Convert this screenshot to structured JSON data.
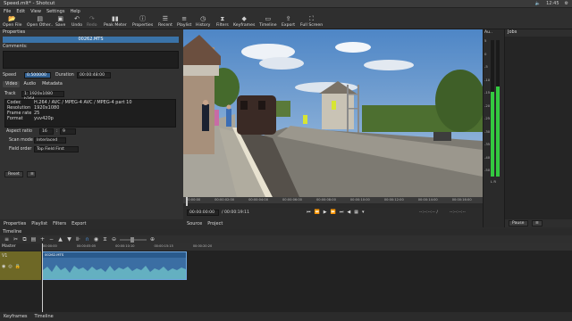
{
  "window": {
    "title": "Speed.mlt* - Shotcut",
    "clock": "12:45"
  },
  "menu": [
    "File",
    "Edit",
    "View",
    "Settings",
    "Help"
  ],
  "toolbar": [
    {
      "label": "Open File",
      "icon": "open-file-icon"
    },
    {
      "label": "Open Other..",
      "icon": "open-other-icon"
    },
    {
      "label": "Save",
      "icon": "save-icon"
    },
    {
      "label": "Undo",
      "icon": "undo-icon"
    },
    {
      "label": "Redo",
      "icon": "redo-icon"
    },
    {
      "label": "Peak Meter",
      "icon": "peak-meter-icon"
    },
    {
      "label": "Properties",
      "icon": "properties-icon"
    },
    {
      "label": "Recent",
      "icon": "recent-icon"
    },
    {
      "label": "Playlist",
      "icon": "playlist-icon"
    },
    {
      "label": "History",
      "icon": "history-icon"
    },
    {
      "label": "Filters",
      "icon": "filters-icon"
    },
    {
      "label": "Keyframes",
      "icon": "keyframes-icon"
    },
    {
      "label": "Timeline",
      "icon": "timeline-icon"
    },
    {
      "label": "Export",
      "icon": "export-icon"
    },
    {
      "label": "Full Screen",
      "icon": "fullscreen-icon"
    }
  ],
  "properties": {
    "header": "Properties",
    "clip_name": "00262.MTS",
    "comments_label": "Comments:",
    "speed_label": "Speed",
    "speed_value": "0.500000",
    "duration_label": "Duration",
    "duration_value": "00:00:48:00",
    "tabs": [
      "Video",
      "Audio",
      "Metadata"
    ],
    "track_label": "Track",
    "track_value": "1: 1920x1080 h264",
    "info": [
      {
        "k": "Codec",
        "v": "H.264 / AVC / MPEG-4 AVC / MPEG-4 part 10"
      },
      {
        "k": "Resolution",
        "v": "1920x1080"
      },
      {
        "k": "Frame rate",
        "v": "25"
      },
      {
        "k": "Format",
        "v": "yuv420p"
      }
    ],
    "aspect_label": "Aspect ratio",
    "aspect_w": "16",
    "aspect_h": "9",
    "scan_label": "Scan mode",
    "scan_value": "Interlaced",
    "field_label": "Field order",
    "field_value": "Top Field First",
    "reset_label": "Reset"
  },
  "left_tabs": [
    "Properties",
    "Playlist",
    "Filters",
    "Export"
  ],
  "player": {
    "ruler": [
      "00:00:00",
      "00:00:02:00",
      "00:00:04:00",
      "00:00:06:00",
      "00:00:08:00",
      "00:00:10:00",
      "00:00:12:00",
      "00:00:14:00",
      "00:00:16:00",
      "00:00:18:00"
    ],
    "position": "00:00:00:00",
    "duration": "/ 00:00:19:11",
    "in_point": "--:--:--:-- /",
    "out_point": "--:--:--:--",
    "source_tab": "Source",
    "project_tab": "Project"
  },
  "audio_meter": {
    "label": "Au..",
    "scale": [
      "5",
      "0",
      "-5",
      "-10",
      "-15",
      "-20",
      "-25",
      "-30",
      "-35",
      "-40",
      "-50"
    ],
    "left_level": 0.62,
    "right_level": 0.66,
    "lr": "L R"
  },
  "jobs": {
    "header": "Jobs",
    "pause_label": "Pause"
  },
  "timeline": {
    "header": "Timeline",
    "master": "Master",
    "track": "V1",
    "ruler": [
      "00:00:00",
      "00:00:05:05",
      "00:00:10:10",
      "00:00:15:15",
      "00:00:20:20"
    ],
    "clip_label": "00262.MTS"
  },
  "footer": [
    "Keyframes",
    "Timeline"
  ]
}
